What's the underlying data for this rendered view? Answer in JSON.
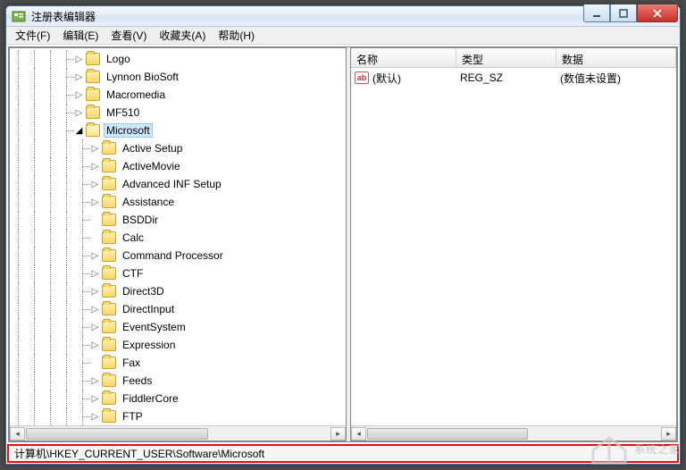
{
  "window": {
    "title": "注册表编辑器"
  },
  "menu": [
    "文件(F)",
    "编辑(E)",
    "查看(V)",
    "收藏夹(A)",
    "帮助(H)"
  ],
  "tree": {
    "top_items": [
      {
        "name": "Logo"
      },
      {
        "name": "Lynnon BioSoft"
      },
      {
        "name": "Macromedia"
      },
      {
        "name": "MF510"
      }
    ],
    "selected": "Microsoft",
    "children": [
      "Active Setup",
      "ActiveMovie",
      "Advanced INF Setup",
      "Assistance",
      "BSDDir",
      "Calc",
      "Command Processor",
      "CTF",
      "Direct3D",
      "DirectInput",
      "EventSystem",
      "Expression",
      "Fax",
      "Feeds",
      "FiddlerCore",
      "FTP"
    ]
  },
  "list": {
    "headers": {
      "name": "名称",
      "type": "类型",
      "data": "数据"
    },
    "row": {
      "name": "(默认)",
      "type": "REG_SZ",
      "data": "(数值未设置)"
    }
  },
  "status": "计算机\\HKEY_CURRENT_USER\\Software\\Microsoft",
  "watermark": "系统之家"
}
